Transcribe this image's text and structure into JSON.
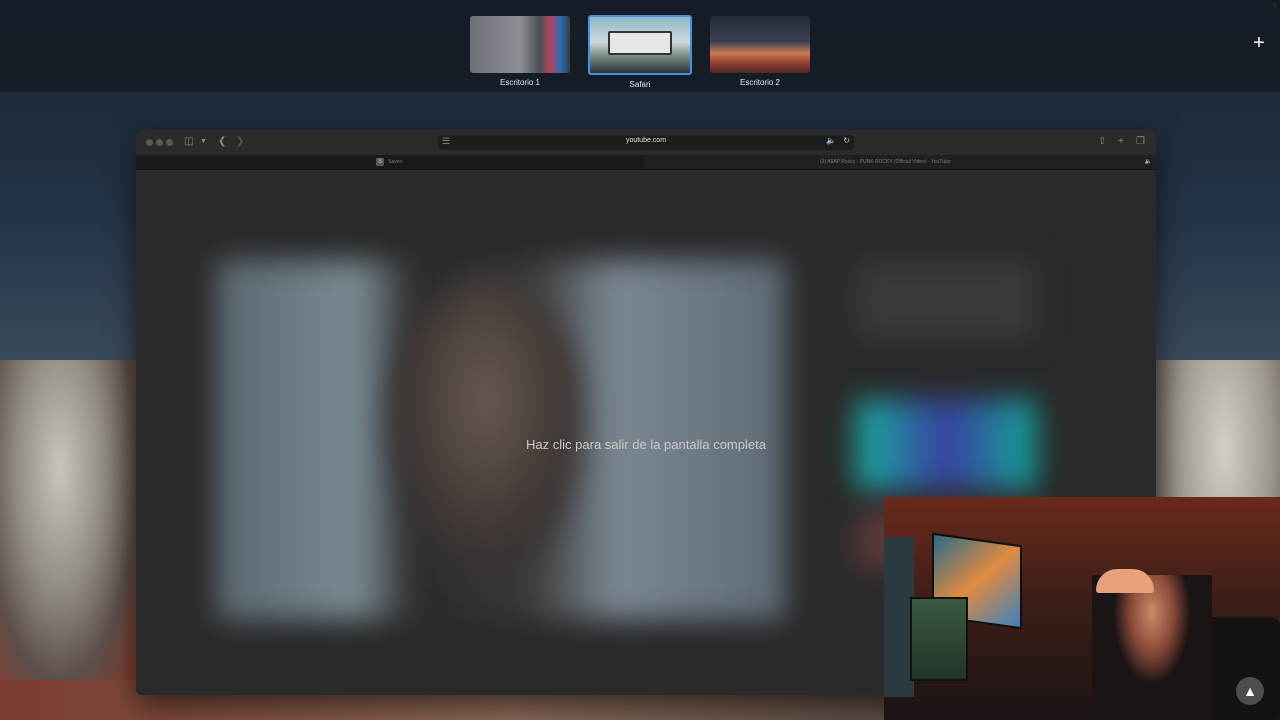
{
  "spaces": [
    {
      "label": "Escritorio 1"
    },
    {
      "label": "Safari"
    },
    {
      "label": "Escritorio 2"
    }
  ],
  "add_space_icon": "+",
  "safari": {
    "url": "youtube.com",
    "tabs": [
      {
        "title": "Savee",
        "favicon": "S"
      },
      {
        "title": "(3) A$AP Rocky - PUNK ROCKY (Official Video) - YouTube"
      }
    ]
  },
  "overlay": {
    "exit_fullscreen_text": "Haz clic para salir de la pantalla completa"
  },
  "icons": {
    "sidebar": "sidebar-icon",
    "back": "chevron-left-icon",
    "forward": "chevron-right-icon",
    "share": "share-icon",
    "new_tab": "plus-icon",
    "tab_overview": "tab-overview-icon",
    "audio": "speaker-icon",
    "reload": "reload-icon"
  },
  "colors": {
    "active_space_border": "#4a90e2",
    "audio_icon": "#4a90e2"
  }
}
